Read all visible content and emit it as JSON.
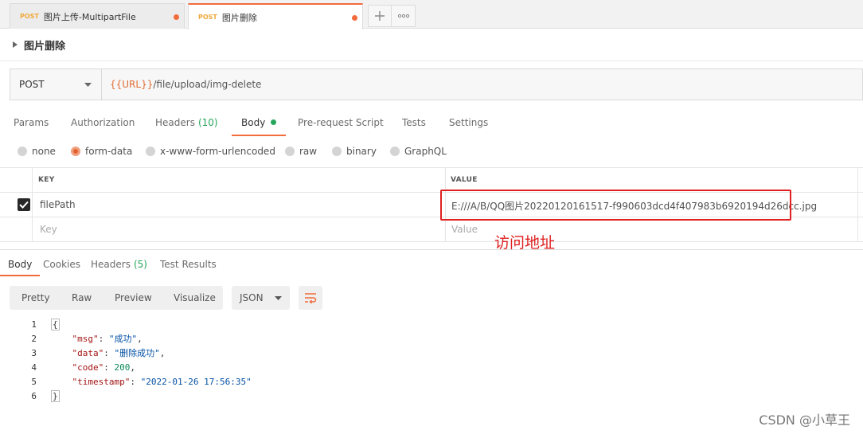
{
  "tabs": [
    {
      "method": "POST",
      "name": "图片上传-MultipartFile",
      "active": false
    },
    {
      "method": "POST",
      "name": "图片删除",
      "active": true
    }
  ],
  "tabbar": {
    "add_icon": "plus-icon",
    "more_icon": "more-icon"
  },
  "request": {
    "name": "图片删除",
    "method": "POST",
    "url_var": "{{URL}}",
    "url_path": "/file/upload/img-delete"
  },
  "request_tabs": [
    {
      "label": "Params"
    },
    {
      "label": "Authorization"
    },
    {
      "label": "Headers",
      "count": "(10)"
    },
    {
      "label": "Body",
      "active": true
    },
    {
      "label": "Pre-request Script"
    },
    {
      "label": "Tests"
    },
    {
      "label": "Settings"
    }
  ],
  "body_types": [
    {
      "label": "none",
      "selected": false
    },
    {
      "label": "form-data",
      "selected": true
    },
    {
      "label": "x-www-form-urlencoded",
      "selected": false
    },
    {
      "label": "raw",
      "selected": false
    },
    {
      "label": "binary",
      "selected": false
    },
    {
      "label": "GraphQL",
      "selected": false
    }
  ],
  "params_table": {
    "headers": [
      "KEY",
      "VALUE"
    ],
    "rows": [
      {
        "checked": true,
        "key": "filePath",
        "value": "E:///A/B/QQ图片20220120161517-f990603dcd4f407983b6920194d26dcc.jpg"
      }
    ],
    "placeholder": {
      "key": "Key",
      "value": "Value"
    }
  },
  "annotation": "访问地址",
  "highlight_color": "#e02020",
  "response_tabs": [
    {
      "label": "Body",
      "active": true
    },
    {
      "label": "Cookies"
    },
    {
      "label": "Headers",
      "count": "(5)"
    },
    {
      "label": "Test Results"
    }
  ],
  "view_modes": [
    "Pretty",
    "Raw",
    "Preview",
    "Visualize"
  ],
  "format": "JSON",
  "response_json": {
    "msg": "成功",
    "data": "删除成功",
    "code": "200",
    "timestamp": "2022-01-26 17:56:35"
  },
  "line_numbers": [
    "1",
    "2",
    "3",
    "4",
    "5",
    "6"
  ],
  "watermark": "CSDN @小草王",
  "colors": {
    "accent": "#f26b3a",
    "method": "#f0a93b",
    "count": "#26a65b"
  }
}
